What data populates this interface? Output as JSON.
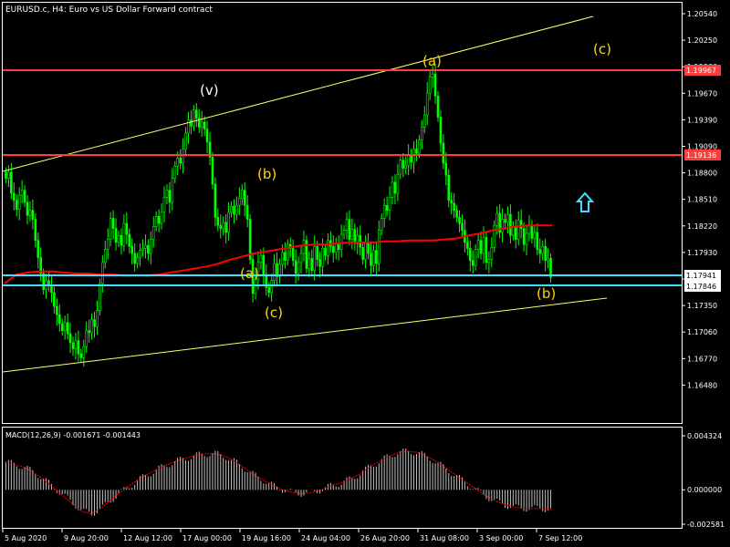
{
  "title": "EURUSD.c, H4:  Euro vs US Dollar Forward contract",
  "macd_label": "MACD(12,26,9) -0.001671 -0.001443",
  "colors": {
    "background": "#000000",
    "candle": "#00ff00",
    "ma": "#ff0000",
    "resistance": "#ff3b3b",
    "support": "#3fe0ff",
    "channel": "#ffff66",
    "wave_label": "#ffd700",
    "macd_hist": "#c0c0c0",
    "macd_signal": "#ff0000",
    "arrow": "#3fe0ff"
  },
  "price_axis": {
    "ticks": [
      "1.20540",
      "1.20250",
      "1.19960",
      "1.19670",
      "1.19390",
      "1.19090",
      "1.18800",
      "1.18510",
      "1.18220",
      "1.17930",
      "1.17640",
      "1.17350",
      "1.17060",
      "1.16770",
      "1.16480"
    ],
    "tag_high": "1.19967",
    "tag_mid": "1.19136",
    "tag_support1": "1.17941",
    "tag_support2": "1.17846"
  },
  "macd_axis": {
    "ticks": [
      "0.004324",
      "0.000000",
      "-0.002581"
    ]
  },
  "time_axis": {
    "ticks": [
      "5 Aug 2020",
      "9 Aug 20:00",
      "12 Aug 12:00",
      "17 Aug 00:00",
      "19 Aug 16:00",
      "24 Aug 04:00",
      "26 Aug 20:00",
      "31 Aug 08:00",
      "3 Sep 00:00",
      "7 Sep 12:00"
    ]
  },
  "wave_labels": {
    "v": "(v)",
    "b1": "(b)",
    "a1": "(a)",
    "c1": "(c)",
    "a2": "(a)",
    "c2": "(c)",
    "b2": "(b)"
  },
  "chart_data": {
    "type": "candlestick",
    "symbol": "EURUSD.c",
    "timeframe": "H4",
    "price_range": [
      1.1648,
      1.2068
    ],
    "horizontal_levels": [
      1.19967,
      1.19136,
      1.17941,
      1.17846
    ],
    "close": [
      1.1893,
      1.1899,
      1.1878,
      1.1871,
      1.1862,
      1.1876,
      1.1881,
      1.1869,
      1.1856,
      1.1861,
      1.1852,
      1.1831,
      1.1814,
      1.1798,
      1.1782,
      1.1791,
      1.1786,
      1.1779,
      1.1765,
      1.1757,
      1.1748,
      1.1741,
      1.1749,
      1.1738,
      1.1729,
      1.1723,
      1.1731,
      1.1718,
      1.1714,
      1.1725,
      1.1741,
      1.1739,
      1.1752,
      1.1745,
      1.1761,
      1.1788,
      1.1809,
      1.1822,
      1.1832,
      1.1853,
      1.1843,
      1.1829,
      1.1836,
      1.1826,
      1.1848,
      1.1837,
      1.1825,
      1.1818,
      1.1808,
      1.1814,
      1.1821,
      1.1823,
      1.1826,
      1.1818,
      1.1832,
      1.1845,
      1.1855,
      1.1848,
      1.1859,
      1.1874,
      1.1881,
      1.1869,
      1.1893,
      1.1905,
      1.1913,
      1.1908,
      1.1922,
      1.1938,
      1.1951,
      1.1945,
      1.1961,
      1.1953,
      1.1944,
      1.1949,
      1.1942,
      1.1929,
      1.1914,
      1.1887,
      1.1854,
      1.1846,
      1.1843,
      1.1849,
      1.1839,
      1.1859,
      1.1865,
      1.1857,
      1.1866,
      1.1873,
      1.1881,
      1.1866,
      1.1852,
      1.1812,
      1.1778,
      1.1792,
      1.1809,
      1.1816,
      1.1797,
      1.1784,
      1.1779,
      1.1791,
      1.1808,
      1.1795,
      1.1807,
      1.1819,
      1.1811,
      1.1827,
      1.1823,
      1.1811,
      1.1798,
      1.1809,
      1.1818,
      1.1831,
      1.1803,
      1.1813,
      1.1801,
      1.1825,
      1.1812,
      1.1805,
      1.1823,
      1.1816,
      1.1831,
      1.1825,
      1.1819,
      1.1828,
      1.1822,
      1.1837,
      1.1841,
      1.1852,
      1.1832,
      1.1842,
      1.1828,
      1.1836,
      1.1824,
      1.1812,
      1.1829,
      1.1818,
      1.1806,
      1.1821,
      1.1808,
      1.1841,
      1.1853,
      1.1866,
      1.1861,
      1.1874,
      1.1889,
      1.1878,
      1.1897,
      1.1911,
      1.1903,
      1.1906,
      1.1916,
      1.1909,
      1.1922,
      1.1918,
      1.1931,
      1.1944,
      1.1956,
      1.1978,
      1.1994,
      1.1997,
      1.1975,
      1.1954,
      1.1928,
      1.1908,
      1.1896,
      1.1871,
      1.1868,
      1.1861,
      1.1854,
      1.1848,
      1.1841,
      1.1829,
      1.1823,
      1.1811,
      1.1806,
      1.1822,
      1.1831,
      1.1818,
      1.1834,
      1.1809,
      1.1812,
      1.1824,
      1.1846,
      1.1858,
      1.1839,
      1.1852,
      1.1849,
      1.1857,
      1.1836,
      1.1845,
      1.1832,
      1.1851,
      1.1843,
      1.1827,
      1.1838,
      1.1846,
      1.1833,
      1.1839,
      1.1822,
      1.1818,
      1.1825,
      1.1811,
      1.1813,
      1.1794
    ],
    "moving_average": [
      1.1788,
      1.1797,
      1.1799,
      1.18,
      1.18,
      1.1799,
      1.1798,
      1.1798,
      1.1797,
      1.1797,
      1.1796,
      1.1796,
      1.1796,
      1.1797,
      1.1799,
      1.1801,
      1.1803,
      1.1805,
      1.1808,
      1.1812,
      1.1815,
      1.1818,
      1.182,
      1.1822,
      1.1824,
      1.1826,
      1.1827,
      1.1827,
      1.1828,
      1.1829,
      1.1829,
      1.1829,
      1.183,
      1.183,
      1.1831,
      1.1831,
      1.1831,
      1.1832,
      1.1833,
      1.1836,
      1.1838,
      1.1841,
      1.1843,
      1.1845,
      1.1846,
      1.1846,
      1.1846
    ],
    "macd_range": [
      -0.002581,
      0.004324
    ],
    "macd_signal": [
      0.0021,
      0.0019,
      0.0017,
      0.0013,
      0.0008,
      0.0002,
      -0.0004,
      -0.001,
      -0.0016,
      -0.0018,
      -0.0014,
      -0.0008,
      -0.0002,
      0.0003,
      0.0008,
      0.0012,
      0.0016,
      0.0019,
      0.0022,
      0.0024,
      0.0026,
      0.0027,
      0.0027,
      0.0025,
      0.0021,
      0.0016,
      0.0011,
      0.0007,
      0.0003,
      0.0,
      -0.0002,
      -0.0003,
      -0.0002,
      0.0,
      0.0003,
      0.0005,
      0.0008,
      0.0012,
      0.0017,
      0.0021,
      0.0025,
      0.0028,
      0.0029,
      0.0028,
      0.0025,
      0.0021,
      0.0016,
      0.0011,
      0.0006,
      0.0001,
      -0.0004,
      -0.0008,
      -0.0011,
      -0.0013,
      -0.0014,
      -0.0014,
      -0.0014,
      -0.0015
    ]
  }
}
